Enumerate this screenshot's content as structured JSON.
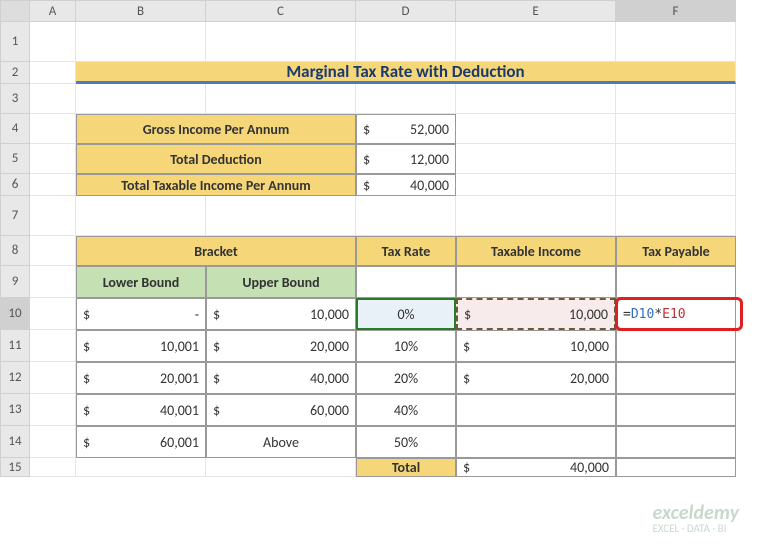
{
  "columns": [
    "",
    "A",
    "B",
    "C",
    "D",
    "E",
    "F"
  ],
  "rows": [
    "1",
    "2",
    "3",
    "4",
    "5",
    "6",
    "7",
    "8",
    "9",
    "10",
    "11",
    "12",
    "13",
    "14",
    "15"
  ],
  "title": "Marginal Tax Rate with Deduction",
  "summary": {
    "gross_label": "Gross Income Per Annum",
    "gross_value": "52,000",
    "deduction_label": "Total Deduction",
    "deduction_value": "12,000",
    "taxable_label": "Total Taxable Income Per Annum",
    "taxable_value": "40,000"
  },
  "headers": {
    "bracket": "Bracket",
    "tax_rate": "Tax Rate",
    "taxable_income": "Taxable Income",
    "tax_payable": "Tax Payable",
    "lower_bound": "Lower Bound",
    "upper_bound": "Upper Bound",
    "total": "Total"
  },
  "chart_data": {
    "type": "table",
    "columns": [
      "Lower Bound",
      "Upper Bound",
      "Tax Rate",
      "Taxable Income",
      "Tax Payable"
    ],
    "rows": [
      {
        "lower": "-",
        "upper": "10,000",
        "rate": "0%",
        "taxable": "10,000",
        "payable": ""
      },
      {
        "lower": "10,001",
        "upper": "20,000",
        "rate": "10%",
        "taxable": "10,000",
        "payable": ""
      },
      {
        "lower": "20,001",
        "upper": "40,000",
        "rate": "20%",
        "taxable": "20,000",
        "payable": ""
      },
      {
        "lower": "40,001",
        "upper": "60,000",
        "rate": "40%",
        "taxable": "",
        "payable": ""
      },
      {
        "lower": "60,001",
        "upper": "Above",
        "rate": "50%",
        "taxable": "",
        "payable": ""
      }
    ],
    "total_taxable": "40,000"
  },
  "currency": "$",
  "formula": {
    "prefix": "=",
    "ref1": "D10",
    "op": "*",
    "ref2": "E10"
  },
  "selected_cell": "F",
  "selected_row": "10",
  "watermark": {
    "brand": "exceldemy",
    "tag": "EXCEL · DATA · BI"
  }
}
